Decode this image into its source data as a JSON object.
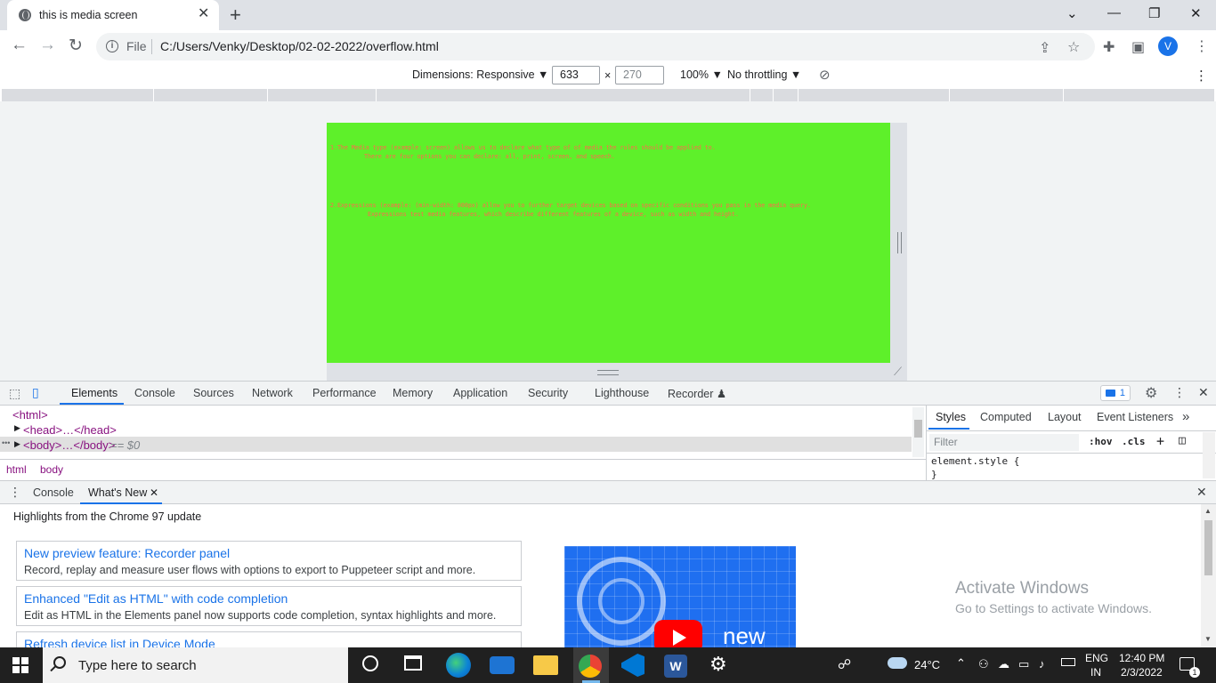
{
  "browser": {
    "tab_title": "this is media screen",
    "tab_close": "✕",
    "new_tab": "+",
    "window_controls": {
      "chevron": "⌄",
      "minimize": "—",
      "restore": "❐",
      "close": "✕"
    },
    "nav": {
      "back": "←",
      "forward": "→",
      "reload": "↻"
    },
    "address": {
      "scheme_label": "File",
      "url": "C:/Users/Venky/Desktop/02-02-2022/overflow.html"
    },
    "profile_initial": "V",
    "menu": "⋮"
  },
  "device_toolbar": {
    "dimensions_label": "Dimensions: Responsive ▼",
    "width": "633",
    "times": "×",
    "height": "270",
    "zoom": "100% ▼",
    "throttling": "No throttling ▼",
    "menu": "⋮"
  },
  "page": {
    "bg_color": "#5ef02a",
    "text_color": "#ff6a4d",
    "para1_line1": "1.The Media type (example: screen) allows us to declare what type of of media the rules should be applied to.",
    "para1_line2": "There are four options you can declare: all, print, screen, and speech.",
    "para2_line1": "2.Expressions (example: (min-width: 800px) allow you to further target devices based on specific conditions you pass in the media query.",
    "para2_line2": "Expressions test media features, which describe different features of a device, such as width and height."
  },
  "devtools": {
    "tabs": [
      "Elements",
      "Console",
      "Sources",
      "Network",
      "Performance",
      "Memory",
      "Application",
      "Security",
      "Lighthouse",
      "Recorder ♟"
    ],
    "issues_count": "1",
    "close": "✕",
    "menu": "⋮",
    "elements_tree": {
      "html_open": "<html>",
      "head": "<head>…</head>",
      "body": "<body>…</body>",
      "selected_marker": "== $0",
      "row_dots": "•••"
    },
    "breadcrumbs": [
      "html",
      "body"
    ],
    "styles_tabs": [
      "Styles",
      "Computed",
      "Layout",
      "Event Listeners",
      "»"
    ],
    "filter_placeholder": "Filter",
    "filter_hov": ":hov",
    "filter_cls": ".cls",
    "filter_plus": "+",
    "element_style_line1": "element.style {",
    "element_style_line2": "}"
  },
  "drawer": {
    "tabs": [
      "Console",
      "What's New"
    ],
    "close_tab": "✕",
    "close_drawer": "✕",
    "menu": "⋮",
    "highlights": "Highlights from the Chrome 97 update",
    "cards": [
      {
        "title": "New preview feature: Recorder panel",
        "desc": "Record, replay and measure user flows with options to export to Puppeteer script and more."
      },
      {
        "title": "Enhanced \"Edit as HTML\" with code completion",
        "desc": "Edit as HTML in the Elements panel now supports code completion, syntax highlights and more."
      },
      {
        "title": "Refresh device list in Device Mode",
        "desc": ""
      }
    ],
    "video_word": "new"
  },
  "watermark": {
    "line1": "Activate Windows",
    "line2": "Go to Settings to activate Windows."
  },
  "taskbar": {
    "search_placeholder": "Type here to search",
    "weather": "24°C",
    "lang1": "ENG",
    "lang2": "IN",
    "time": "12:40 PM",
    "date": "2/3/2022",
    "notif_count": "1",
    "tray_caret": "⌃"
  }
}
